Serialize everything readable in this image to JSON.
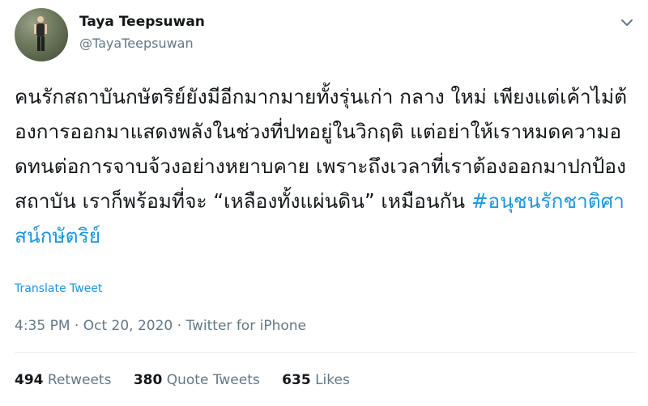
{
  "user": {
    "display_name": "Taya Teepsuwan",
    "handle": "@TayaTeepsuwan",
    "avatar_icon": "profile-photo-runner"
  },
  "tweet": {
    "text": "คนรักสถาบันกษัตริย์ยังมีอีกมากมายทั้งรุ่นเก่า กลาง ใหม่ เพียงแต่เค้าไม่ต้องการออกมาแสดงพลังในช่วงที่ปทอยู่ในวิกฤติ แต่อย่าให้เราหมดความอดทนต่อการจาบจ้วงอย่างหยาบคาย เพราะถึงเวลาที่เราต้องออกมาปกป้องสถาบัน เราก็พร้อมที่จะ “เหลืองทั้งแผ่นดิน” เหมือนกัน",
    "hashtag": "#อนุชนรักชาติศาสน์กษัตริย์",
    "translate_label": "Translate Tweet",
    "time": "4:35 PM",
    "date": "Oct 20, 2020",
    "source": "Twitter for iPhone",
    "separator": "·"
  },
  "stats": {
    "retweets_count": "494",
    "retweets_label": "Retweets",
    "quotes_count": "380",
    "quotes_label": "Quote Tweets",
    "likes_count": "635",
    "likes_label": "Likes"
  },
  "colors": {
    "accent": "#1b95e0",
    "text_primary": "#14171a",
    "text_secondary": "#657786",
    "divider": "#e6ecf0"
  }
}
